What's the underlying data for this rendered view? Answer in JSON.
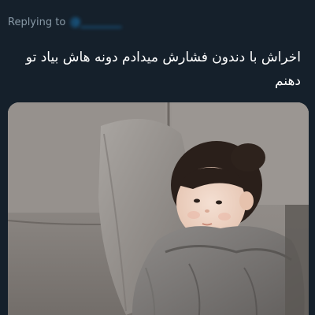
{
  "reply": {
    "prefix": "Replying to",
    "handle": "@________"
  },
  "tweet": {
    "text": "اخراش با دندون فشارش میدادم دونه هاش بیاد تو دهنم"
  },
  "media": {
    "description_icon": "photo-attachment"
  },
  "colors": {
    "background": "#15202b",
    "secondary_text": "#8899a6",
    "link": "#1d9bf0",
    "primary_text": "#ffffff"
  }
}
